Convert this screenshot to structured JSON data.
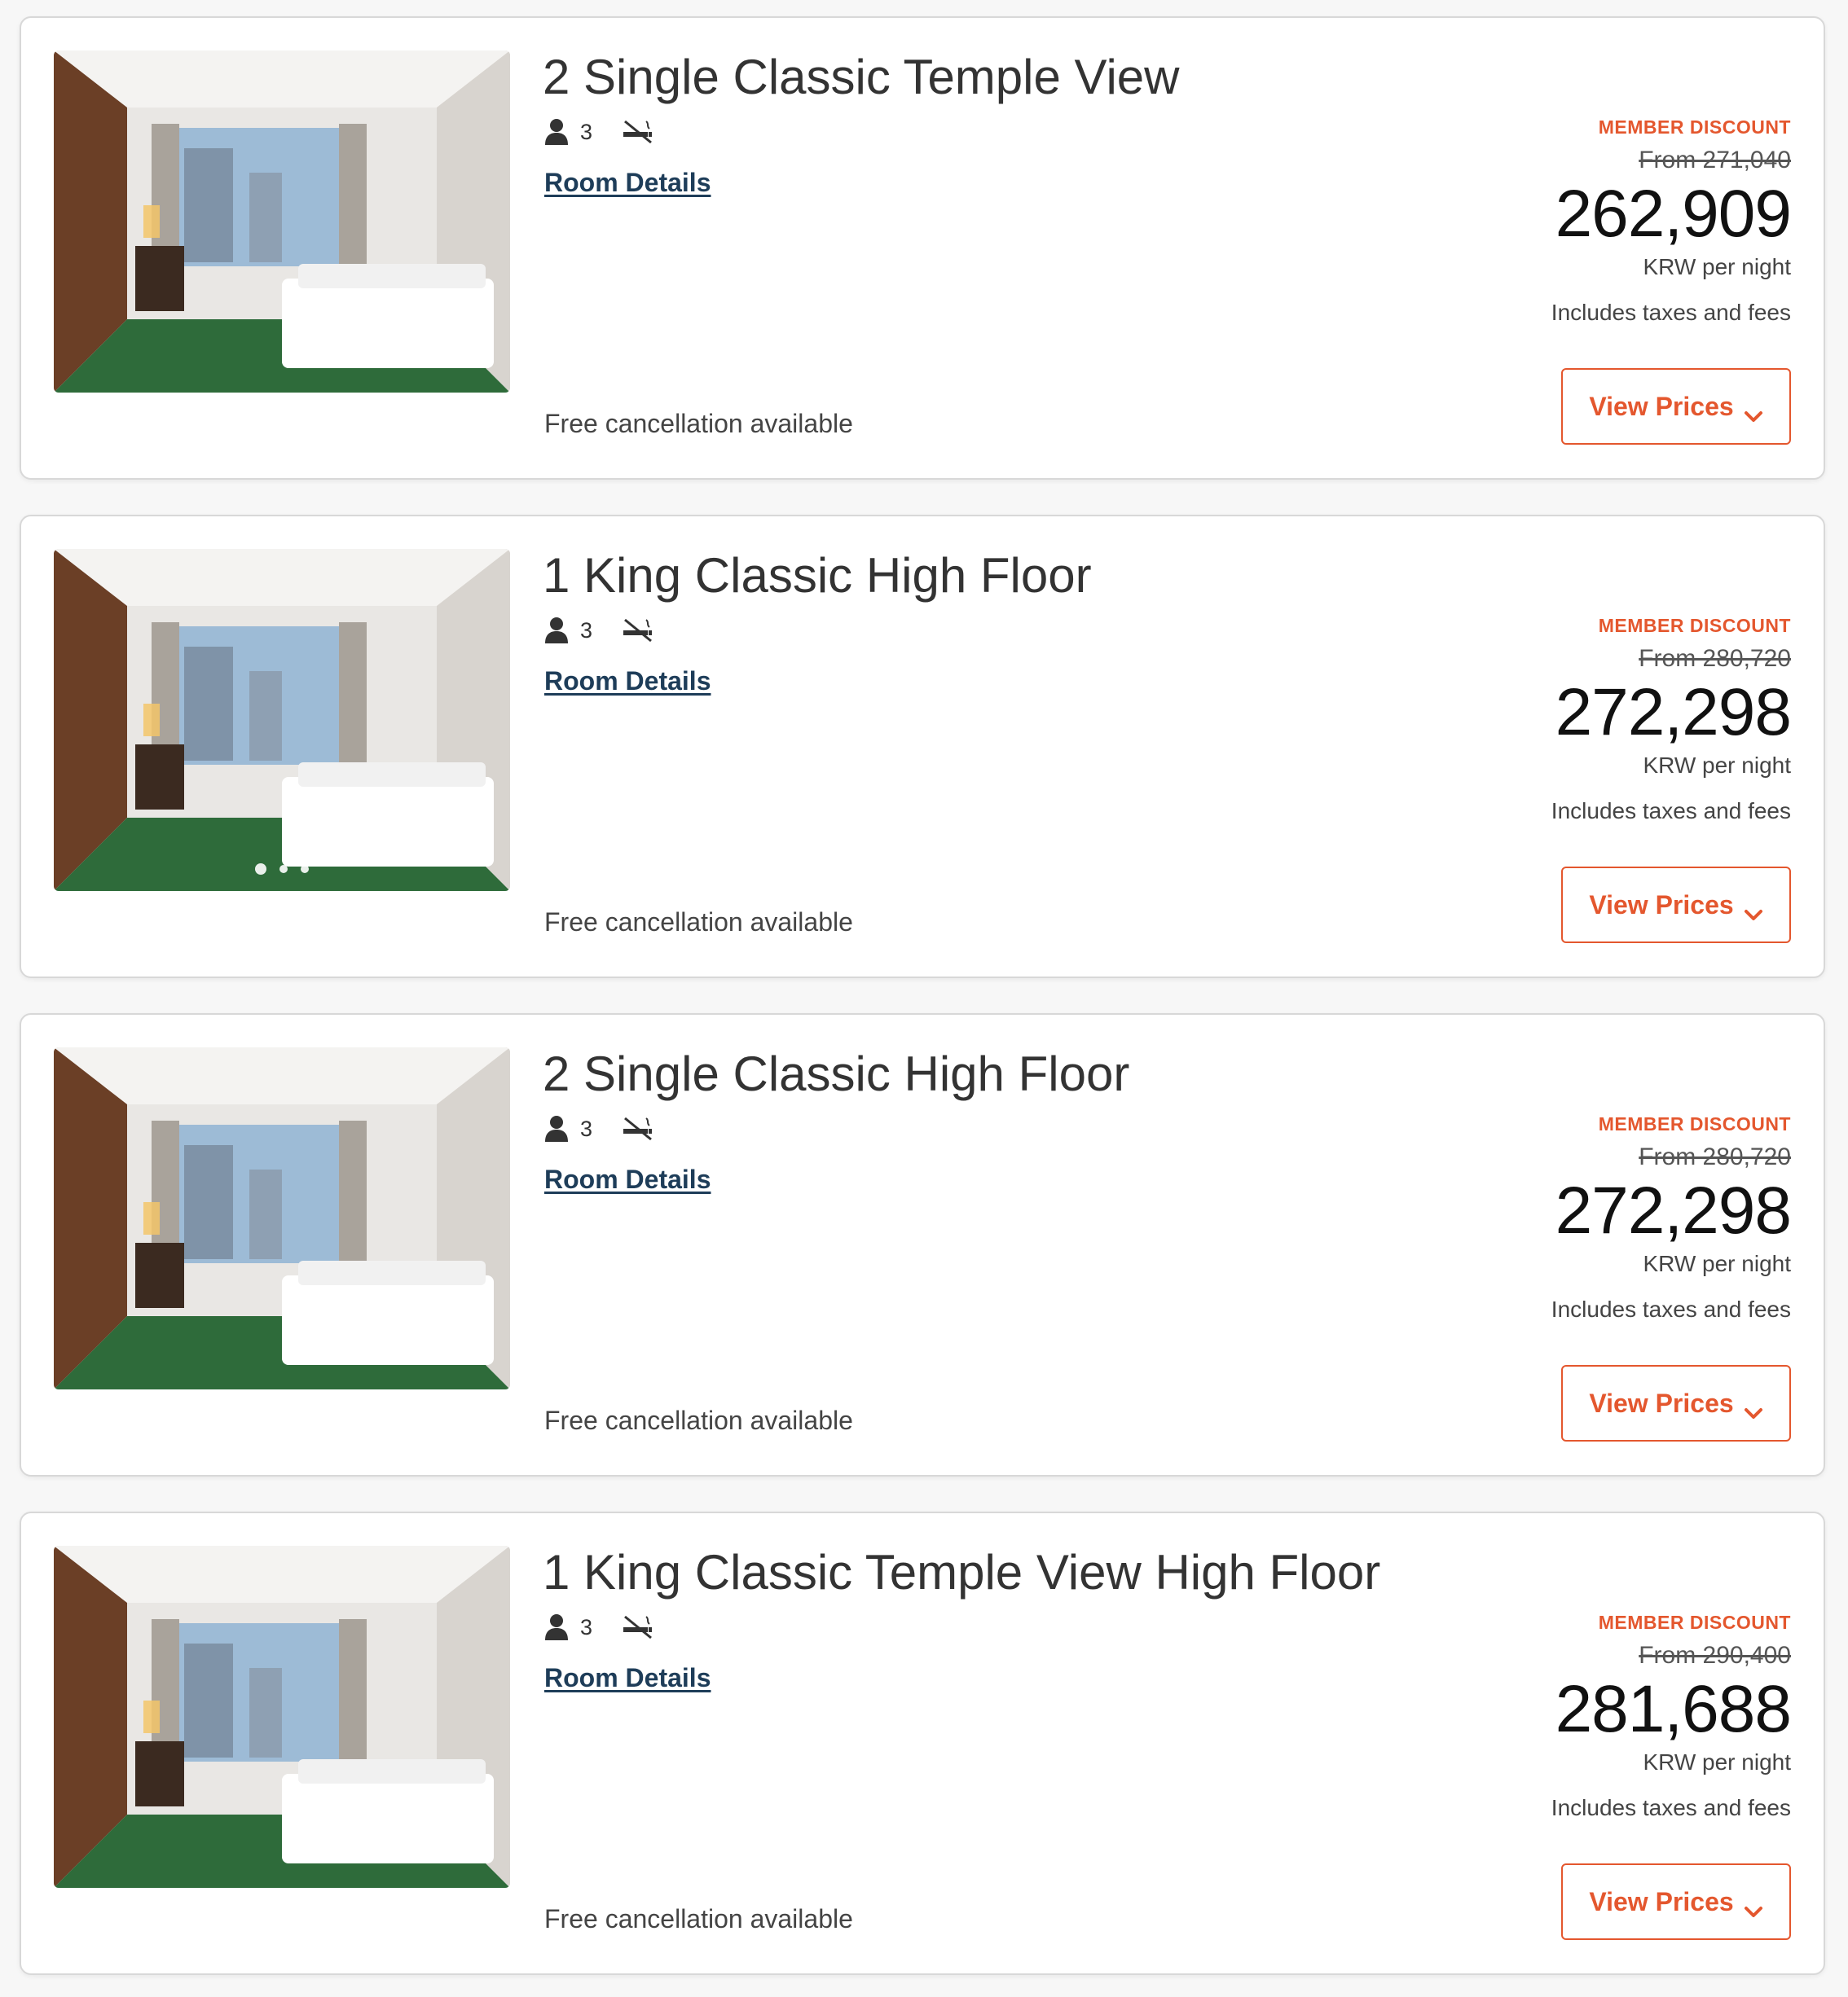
{
  "rooms": [
    {
      "title": "2 Single Classic Temple View",
      "occupancy": "3",
      "details_label": "Room Details",
      "discount_label": "MEMBER DISCOUNT",
      "was_price": "From 271,040",
      "price": "262,909",
      "unit": "KRW per night",
      "taxes": "Includes taxes and fees",
      "button_label": "View Prices",
      "cancellation": "Free cancellation available",
      "carousel_dots": 0
    },
    {
      "title": "1 King Classic High Floor",
      "occupancy": "3",
      "details_label": "Room Details",
      "discount_label": "MEMBER DISCOUNT",
      "was_price": "From 280,720",
      "price": "272,298",
      "unit": "KRW per night",
      "taxes": "Includes taxes and fees",
      "button_label": "View Prices",
      "cancellation": "Free cancellation available",
      "carousel_dots": 3
    },
    {
      "title": "2 Single Classic High Floor",
      "occupancy": "3",
      "details_label": "Room Details",
      "discount_label": "MEMBER DISCOUNT",
      "was_price": "From 280,720",
      "price": "272,298",
      "unit": "KRW per night",
      "taxes": "Includes taxes and fees",
      "button_label": "View Prices",
      "cancellation": "Free cancellation available",
      "carousel_dots": 0
    },
    {
      "title": "1 King Classic Temple View High Floor",
      "occupancy": "3",
      "details_label": "Room Details",
      "discount_label": "MEMBER DISCOUNT",
      "was_price": "From 290,400",
      "price": "281,688",
      "unit": "KRW per night",
      "taxes": "Includes taxes and fees",
      "button_label": "View Prices",
      "cancellation": "Free cancellation available",
      "carousel_dots": 0
    }
  ],
  "icons": {
    "occupancy": "person-icon",
    "smoking": "no-smoking-icon",
    "button": "chevron-down-icon"
  },
  "colors": {
    "accent": "#e4572e",
    "link": "#1e3d59",
    "card_border": "#d8d8d8",
    "carpet_green": "#2e6b3a"
  }
}
